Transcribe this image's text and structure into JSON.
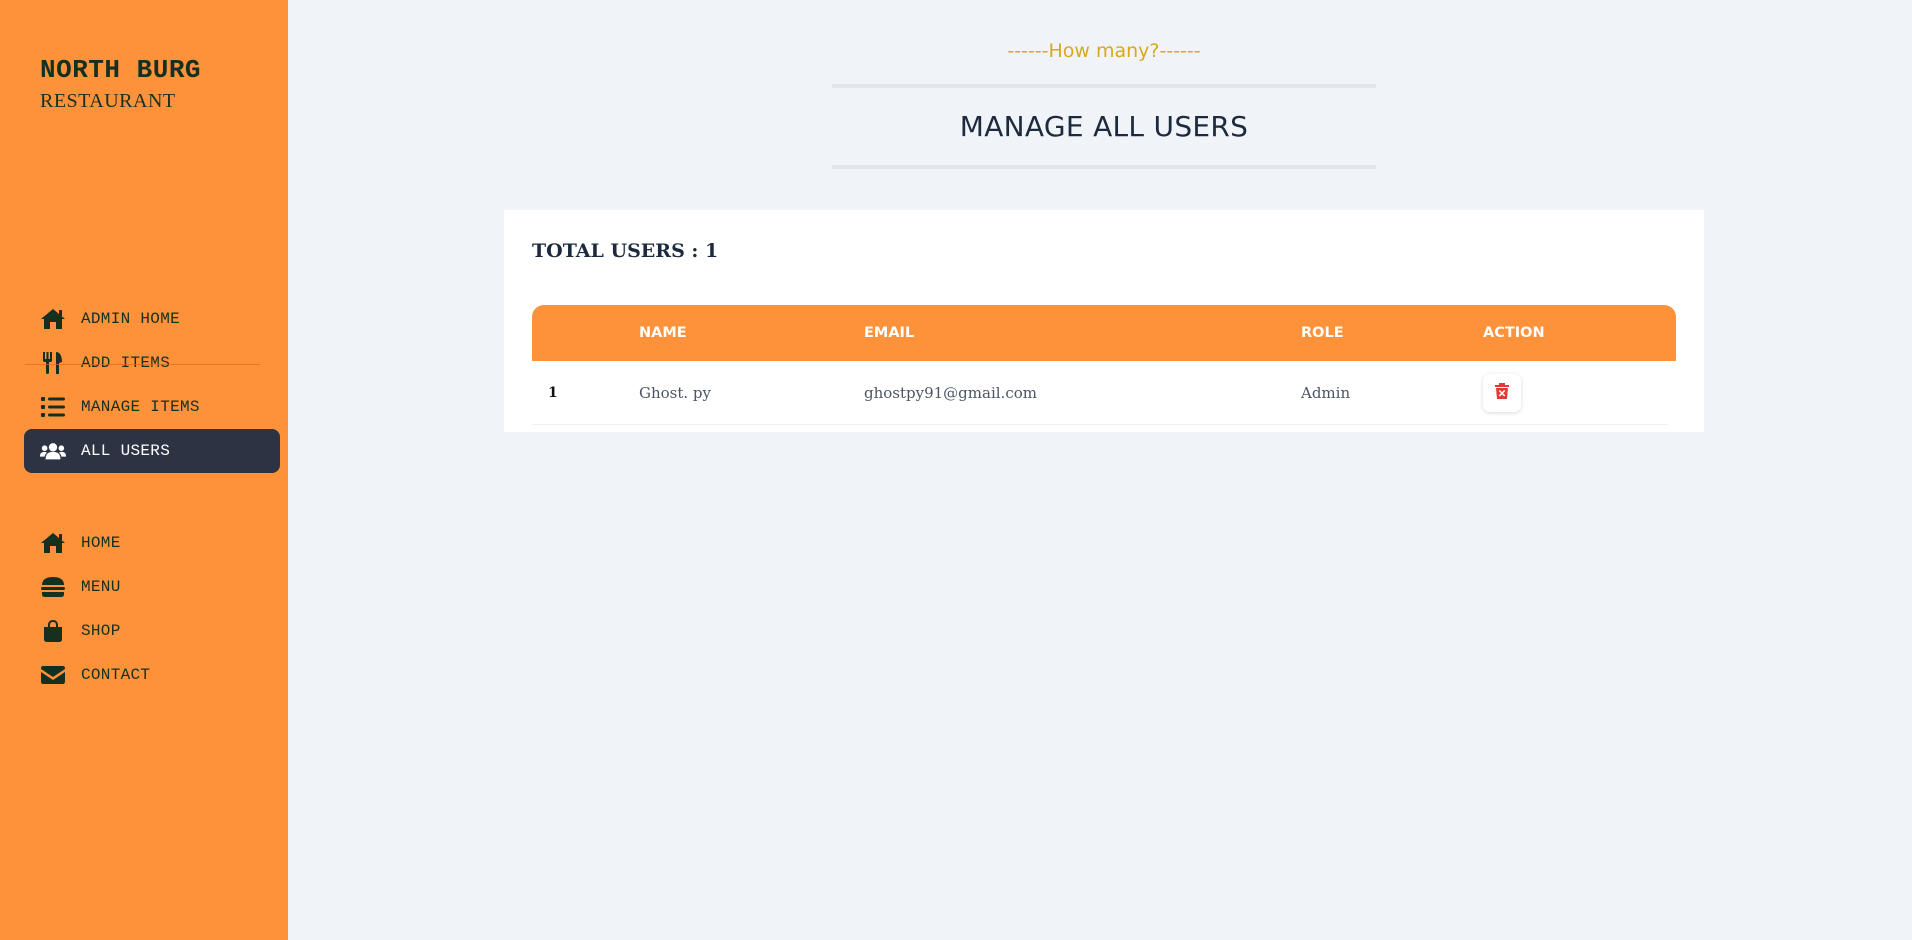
{
  "brand": {
    "name": "NORTH BURG",
    "sub": "RESTAURANT"
  },
  "sidebar": {
    "admin_items": [
      {
        "label": "ADMIN HOME",
        "icon": "home-icon"
      },
      {
        "label": "ADD ITEMS",
        "icon": "utensils-icon"
      },
      {
        "label": "MANAGE ITEMS",
        "icon": "list-icon"
      },
      {
        "label": "ALL USERS",
        "icon": "users-icon",
        "active": true
      }
    ],
    "main_items": [
      {
        "label": "HOME",
        "icon": "home-icon"
      },
      {
        "label": "MENU",
        "icon": "burger-icon"
      },
      {
        "label": "SHOP",
        "icon": "shopping-bag-icon"
      },
      {
        "label": "CONTACT",
        "icon": "envelope-icon"
      }
    ]
  },
  "header": {
    "subheading": "------How many?------",
    "title": "MANAGE ALL USERS"
  },
  "users": {
    "total_label": "TOTAL USERS : 1",
    "columns": [
      "",
      "NAME",
      "EMAIL",
      "ROLE",
      "ACTION"
    ],
    "rows": [
      {
        "index": "1",
        "name": "Ghost. py",
        "email": "ghostpy91@gmail.com",
        "role": "Admin",
        "action_icon": "trash-icon"
      }
    ]
  },
  "colors": {
    "sidebar_bg": "#fd923b",
    "active_item_bg": "#2c3444",
    "table_header_bg": "#fd923b",
    "accent_text": "#d9a91b",
    "delete_icon": "#e53935"
  }
}
